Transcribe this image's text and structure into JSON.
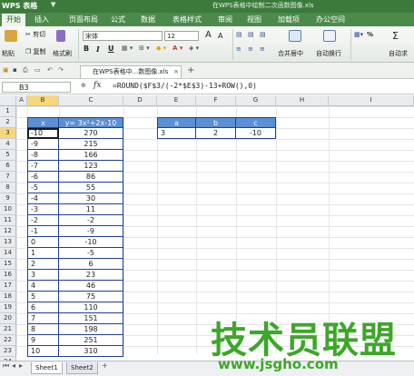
{
  "titlebar": {
    "app_name": "WPS 表格",
    "dropdown": "▼",
    "doc_title": "在WPS表格中绘制二次函数图像.xls"
  },
  "menu": [
    "开始",
    "插入",
    "页面布局",
    "公式",
    "数据",
    "表格样式",
    "审阅",
    "视图",
    "加载项",
    "办公空间"
  ],
  "ribbon": {
    "cut": "剪切",
    "copy": "复制",
    "format_painter": "格式刷",
    "paste": "粘贴",
    "font": "宋体",
    "font_size": "12",
    "grow_font": "A",
    "shrink_font": "A",
    "bold": "B",
    "italic": "I",
    "underline": "U",
    "merge": "合并居中",
    "wrap": "自动换行",
    "percent": "%",
    "autosum": "自动求"
  },
  "doctab": {
    "label": "在WPS表格中...数图像.xls",
    "close": "×",
    "new": "+"
  },
  "formula_bar": {
    "cell_ref": "B3",
    "fx": "fx",
    "formula": "=ROUND($F$3/(-2*$E$3)-13+ROW(),0)"
  },
  "columns": [
    "A",
    "B",
    "C",
    "D",
    "E",
    "F",
    "G",
    "H",
    "I"
  ],
  "rows": [
    "1",
    "2",
    "3",
    "4",
    "5",
    "6",
    "7",
    "8",
    "9",
    "10",
    "11",
    "12",
    "13",
    "14",
    "15",
    "16",
    "17",
    "18",
    "19",
    "20",
    "21",
    "22",
    "23",
    "24"
  ],
  "table": {
    "header_x": "x",
    "header_y": "y= 3x²+2x-10",
    "x": [
      "-10",
      "-9",
      "-8",
      "-7",
      "-6",
      "-5",
      "-4",
      "-3",
      "-2",
      "-1",
      "0",
      "1",
      "2",
      "3",
      "4",
      "5",
      "6",
      "7",
      "8",
      "9",
      "10"
    ],
    "y": [
      "270",
      "215",
      "166",
      "123",
      "86",
      "55",
      "30",
      "11",
      "-2",
      "-9",
      "-10",
      "-5",
      "6",
      "23",
      "46",
      "75",
      "110",
      "151",
      "198",
      "251",
      "310"
    ]
  },
  "params": {
    "headers": [
      "a",
      "b",
      "c"
    ],
    "values": [
      "3",
      "2",
      "-10"
    ]
  },
  "sheets": [
    "Sheet1",
    "Sheet2"
  ],
  "sheet_add": "+",
  "watermark": {
    "brand": "技术员联盟",
    "url": "www.jsgho.com"
  }
}
